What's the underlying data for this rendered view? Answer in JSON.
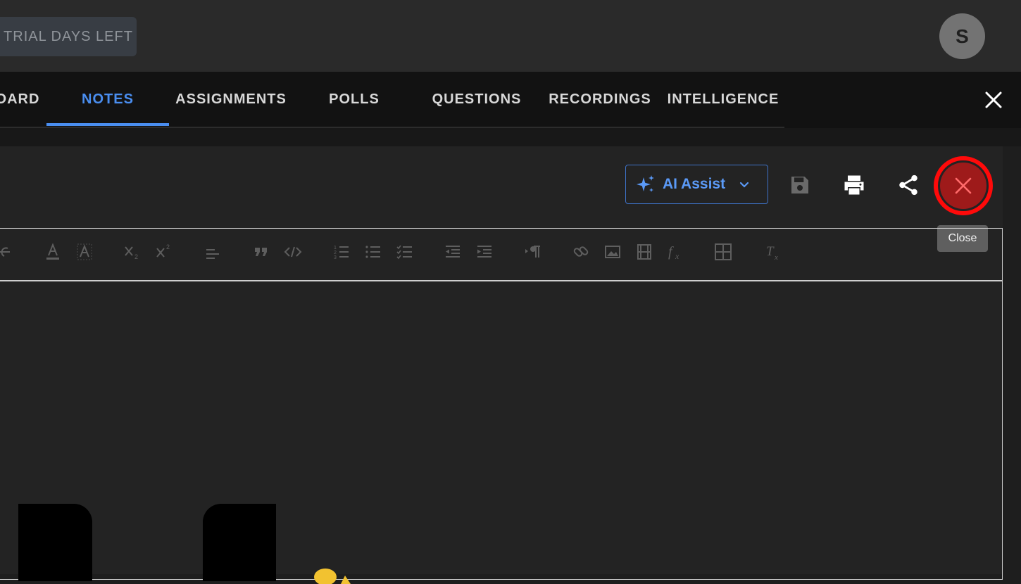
{
  "header": {
    "trial_text": "TRIAL DAYS LEFT",
    "avatar_letter": "S"
  },
  "tabs": [
    {
      "label": "OARD",
      "active": false
    },
    {
      "label": "NOTES",
      "active": true
    },
    {
      "label": "ASSIGNMENTS",
      "active": false
    },
    {
      "label": "POLLS",
      "active": false
    },
    {
      "label": "QUESTIONS",
      "active": false
    },
    {
      "label": "RECORDINGS",
      "active": false
    },
    {
      "label": "INTELLIGENCE",
      "active": false
    }
  ],
  "actions": {
    "ai_assist_label": "AI Assist",
    "close_tooltip": "Close"
  },
  "toolbar_buttons": [
    "strikethrough-icon",
    "font-color-icon",
    "highlight-color-icon",
    "subscript-icon",
    "superscript-icon",
    "align-icon",
    "blockquote-icon",
    "code-icon",
    "ordered-list-icon",
    "bullet-list-icon",
    "checklist-icon",
    "outdent-icon",
    "indent-icon",
    "text-direction-icon",
    "link-icon",
    "image-icon",
    "video-icon",
    "formula-icon",
    "table-icon",
    "clear-format-icon"
  ],
  "colors": {
    "accent": "#4a8ef0",
    "close_highlight": "#ff0a0a",
    "close_fill": "#9e1a1a"
  }
}
